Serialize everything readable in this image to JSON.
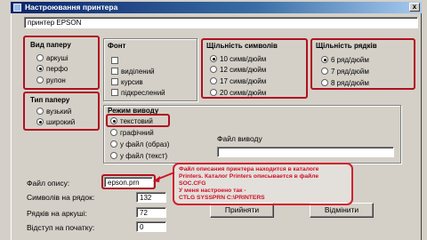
{
  "window": {
    "title": "Настроювання принтера",
    "close_label": "x"
  },
  "printer_name": "принтер EPSON",
  "paper_type": {
    "title": "Вид паперу",
    "options": [
      {
        "label": "аркуші",
        "selected": false
      },
      {
        "label": "перфо",
        "selected": true
      },
      {
        "label": "рулон",
        "selected": false
      }
    ]
  },
  "font": {
    "title": "Фонт",
    "options": [
      {
        "label": "",
        "checked": false
      },
      {
        "label": "виділений",
        "checked": false
      },
      {
        "label": "курсив",
        "checked": false
      },
      {
        "label": "підкреслений",
        "checked": false
      }
    ]
  },
  "char_density": {
    "title": "Щільність символів",
    "options": [
      {
        "label": "10 симв/дюйм",
        "selected": true
      },
      {
        "label": "12 симв/дюйм",
        "selected": false
      },
      {
        "label": "17 симв/дюйм",
        "selected": false
      },
      {
        "label": "20 симв/дюйм",
        "selected": false
      }
    ]
  },
  "line_density": {
    "title": "Щільність рядків",
    "options": [
      {
        "label": "6 ряд/дюйм",
        "selected": true
      },
      {
        "label": "7 ряд/дюйм",
        "selected": false
      },
      {
        "label": "8 ряд/дюйм",
        "selected": false
      }
    ]
  },
  "paper_kind": {
    "title": "Тип паперу",
    "options": [
      {
        "label": "вузький",
        "selected": false
      },
      {
        "label": "широкий",
        "selected": true
      }
    ]
  },
  "output_mode": {
    "title": "Режим виводу",
    "options": [
      {
        "label": "текстовий",
        "selected": true
      },
      {
        "label": "графічний",
        "selected": false
      },
      {
        "label": "у файл (образ)",
        "selected": false
      },
      {
        "label": "у файл (текст)",
        "selected": false
      }
    ],
    "output_file_label": "Файл виводу",
    "output_file_value": ""
  },
  "fields": {
    "description_file_label": "Файл опису:",
    "description_file_value": "epson.prn",
    "chars_per_line_label": "Символів на рядок:",
    "chars_per_line_value": "132",
    "lines_per_page_label": "Рядків на аркуші:",
    "lines_per_page_value": "72",
    "top_margin_label": "Відступ на початку:",
    "top_margin_value": "0"
  },
  "buttons": {
    "accept": "Прийняти",
    "cancel": "Відмінити"
  },
  "annotation": {
    "lines": [
      "Файл описания принтера находится в каталоге",
      "Printers. Каталог Printers описывается в файле",
      "SOC.CFG",
      "У меня настроено так -",
      "CTLG SYSSPRN    C:\\PRINTERS"
    ]
  },
  "colors": {
    "annotation_red": "#d01028",
    "title_blue": "#0a246a",
    "face": "#d4d0c8"
  }
}
